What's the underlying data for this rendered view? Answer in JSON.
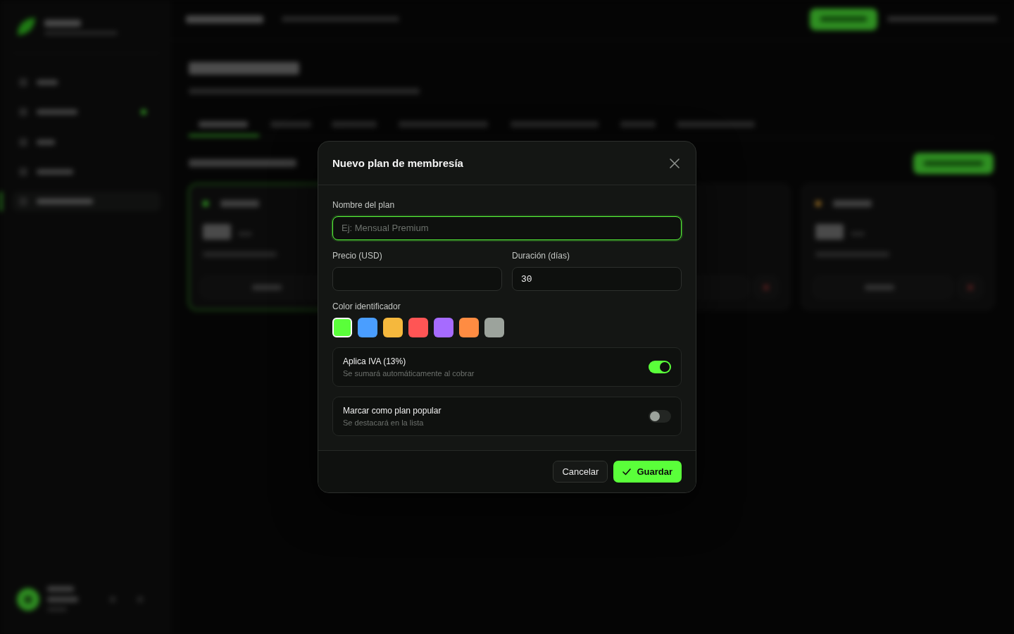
{
  "modal": {
    "title": "Nuevo plan de membresía",
    "fields": [
      {
        "label": "Nombre del plan",
        "placeholder": "Ej: Mensual Premium",
        "focused": true
      },
      {
        "label": "Precio (USD)",
        "focused": false
      },
      {
        "label": "Duración (días)",
        "value": "30",
        "focused": false
      }
    ],
    "color_label": "Color identificador",
    "colors": [
      {
        "color": "#5aff3a",
        "selected": true
      },
      {
        "color": "#4a9eff",
        "selected": false
      },
      {
        "color": "#f5b83d",
        "selected": false
      },
      {
        "color": "#ff5555",
        "selected": false
      },
      {
        "color": "#a66bff",
        "selected": false
      },
      {
        "color": "#ff8c42",
        "selected": false
      },
      {
        "color": "#9ca39c",
        "selected": false
      }
    ],
    "toggles": [
      {
        "label": "Aplica IVA (13%)",
        "hint": "Se sumará automáticamente al cobrar",
        "on": true
      },
      {
        "label": "Marcar como plan popular",
        "hint": "Se destacará en la lista",
        "on": false
      }
    ],
    "buttons": {
      "cancel": "Cancelar",
      "save": "Guardar"
    }
  }
}
